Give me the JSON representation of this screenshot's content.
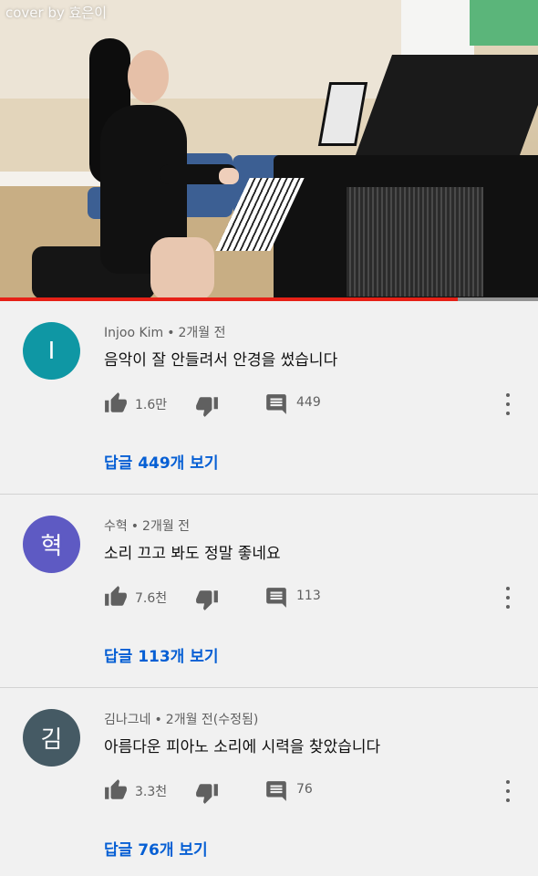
{
  "video": {
    "caption": "cover by 효은이",
    "progress_fraction": 0.85,
    "progress_color": "#e62117"
  },
  "comments": [
    {
      "avatar_letter": "I",
      "avatar_color": "#0f97a4",
      "author": "Injoo Kim",
      "separator": "•",
      "time": "2개월 전",
      "text": "음악이 잘 안들려서 안경을 썼습니다",
      "likes": "1.6만",
      "reply_count": "449",
      "view_replies": "답글 449개 보기"
    },
    {
      "avatar_letter": "혁",
      "avatar_color": "#5e5ac3",
      "author": "수혁",
      "separator": "•",
      "time": "2개월 전",
      "text": "소리 끄고 봐도 정말 좋네요",
      "likes": "7.6천",
      "reply_count": "113",
      "view_replies": "답글 113개 보기"
    },
    {
      "avatar_letter": "김",
      "avatar_color": "#455a64",
      "author": "김나그네",
      "separator": "•",
      "time": "2개월 전(수정됨)",
      "text": "아름다운 피아노 소리에 시력을 찾았습니다",
      "likes": "3.3천",
      "reply_count": "76",
      "view_replies": "답글 76개 보기"
    }
  ],
  "icons": {
    "like": "thumb-up-icon",
    "dislike": "thumb-down-icon",
    "reply": "comment-icon",
    "more": "more-vert-icon"
  }
}
